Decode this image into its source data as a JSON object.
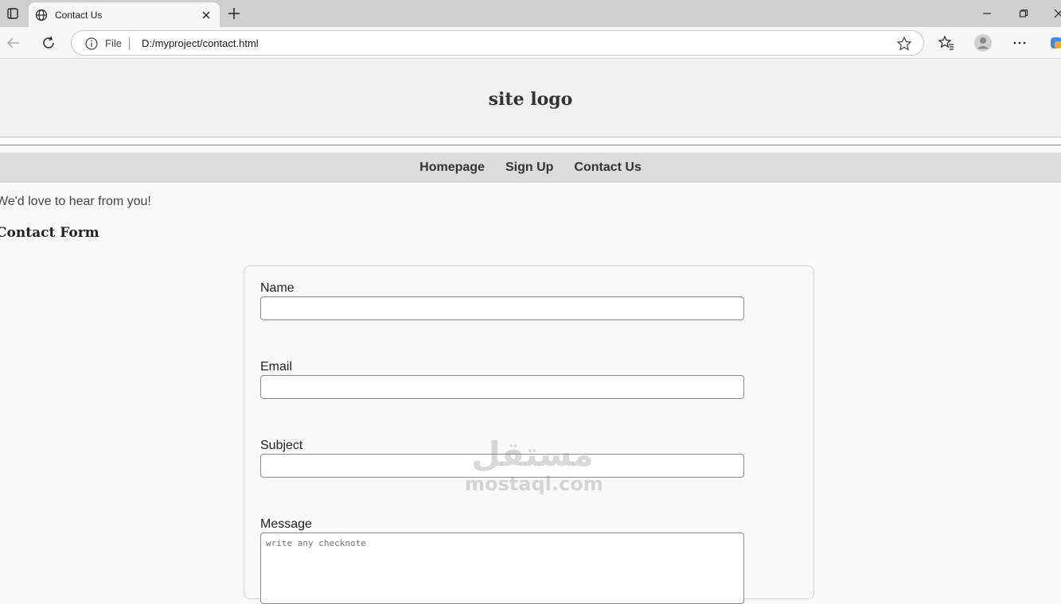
{
  "browser": {
    "tab_title": "Contact Us",
    "omnibox_scheme": "File",
    "omnibox_url": "D:/myproject/contact.html"
  },
  "site": {
    "logo": "site logo",
    "nav": [
      "Homepage",
      "Sign Up",
      "Contact Us"
    ],
    "intro": "We'd love to hear from you!",
    "form_heading": "Contact Form"
  },
  "form": {
    "name_label": "Name",
    "email_label": "Email",
    "subject_label": "Subject",
    "message_label": "Message",
    "message_placeholder": "write any checknote"
  },
  "watermark": {
    "arabic": "مستقل",
    "latin": "mostaql.com"
  }
}
